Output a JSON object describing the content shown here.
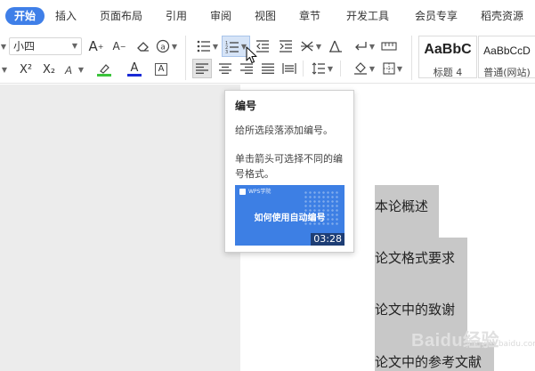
{
  "tabs": [
    {
      "label": "开始",
      "active": true
    },
    {
      "label": "插入"
    },
    {
      "label": "页面布局"
    },
    {
      "label": "引用"
    },
    {
      "label": "审阅"
    },
    {
      "label": "视图"
    },
    {
      "label": "章节"
    },
    {
      "label": "开发工具"
    },
    {
      "label": "会员专享"
    },
    {
      "label": "稻壳资源"
    }
  ],
  "ribbon": {
    "font_size": "小四",
    "grow_font": "A",
    "shrink_font": "A",
    "superscript": "X²",
    "subscript": "X₂",
    "font_color_glyph": "A",
    "char_border_glyph": "A",
    "highlight_color": "#3cc43c",
    "font_color": "#1a2bd6",
    "styles": [
      {
        "sample": "AaBbC",
        "name": "标题 4"
      },
      {
        "sample": "AaBbCcD",
        "name": "普通(网站)"
      }
    ]
  },
  "tooltip": {
    "title": "编号",
    "desc1": "给所选段落添加编号。",
    "desc2": "单击箭头可选择不同的编号格式。",
    "video_logo": "WPS学院",
    "video_title": "如何使用自动编号",
    "video_time": "03:28"
  },
  "document": {
    "headings": [
      "本论概述",
      "论文格式要求",
      "论文中的致谢",
      "论文中的参考文献"
    ]
  },
  "watermark": {
    "text": "Baidu经验",
    "sub": "jingyan.baidu.com"
  },
  "colors": {
    "accent": "#3f7fe8",
    "video_bg": "#3d7fe4",
    "selection": "#c8c8c8"
  }
}
